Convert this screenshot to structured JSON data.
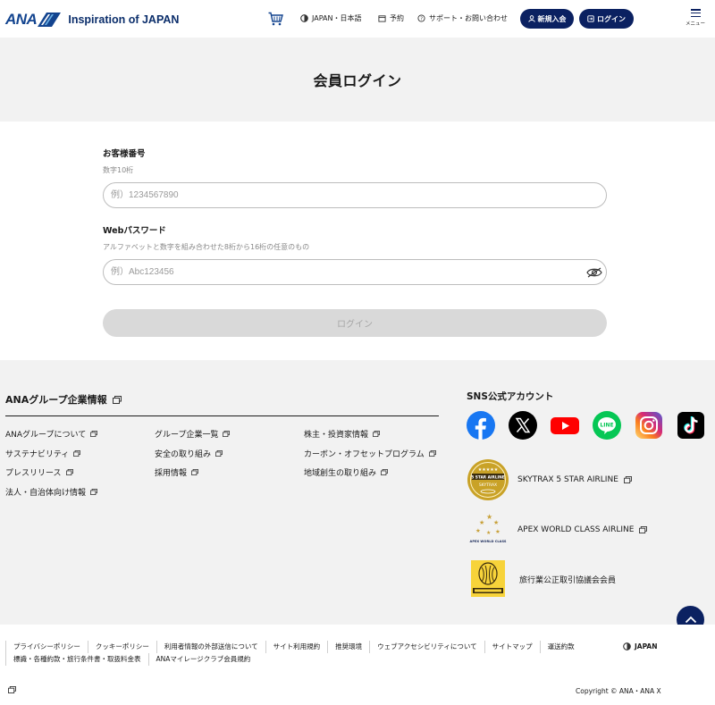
{
  "header": {
    "logo_brand": "ANA",
    "logo_tagline": "Inspiration of JAPAN",
    "nav_region": "JAPAN・日本語",
    "nav_reserve": "予約",
    "nav_support": "サポート・お問い合わせ",
    "signup_label": "新規入会",
    "login_label": "ログイン",
    "menu_label": "メニュー"
  },
  "page": {
    "title": "会員ログイン"
  },
  "form": {
    "customer_number_label": "お客様番号",
    "customer_number_hint": "数字10桁",
    "customer_number_placeholder": "例）1234567890",
    "password_label": "Webパスワード",
    "password_hint": "アルファベットと数字を組み合わせた8桁から16桁の任意のもの",
    "password_placeholder": "例）Abc123456",
    "submit_label": "ログイン"
  },
  "corporate": {
    "title": "ANAグループ企業情報",
    "links": [
      "ANAグループについて",
      "グループ企業一覧",
      "株主・投資家情報",
      "サステナビリティ",
      "安全の取り組み",
      "カーボン・オフセットプログラム",
      "プレスリリース",
      "採用情報",
      "地域創生の取り組み",
      "法人・自治体向け情報"
    ]
  },
  "sns": {
    "title": "SNS公式アカウント",
    "icons": [
      "facebook-icon",
      "x-icon",
      "youtube-icon",
      "line-icon",
      "instagram-icon",
      "tiktok-icon"
    ]
  },
  "awards": {
    "skytrax": "SKYTRAX 5 STAR AIRLINE",
    "apex": "APEX WORLD CLASS AIRLINE",
    "jata": "旅行業公正取引協議会会員"
  },
  "footer": {
    "links": [
      "プライバシーポリシー",
      "クッキーポリシー",
      "利用者情報の外部送信について",
      "サイト利用規約",
      "推奨環境",
      "ウェブアクセシビリティについて",
      "サイトマップ",
      "運送約款",
      "標識・各種約款・旅行条件書・取扱料金表",
      "ANAマイレージクラブ会員規約"
    ],
    "language": "JAPAN",
    "copyright": "Copyright © ANA・ANA X"
  },
  "colors": {
    "brand_navy": "#0b2161",
    "ana_blue": "#13448f",
    "panel_gray": "#f2f2f2"
  }
}
